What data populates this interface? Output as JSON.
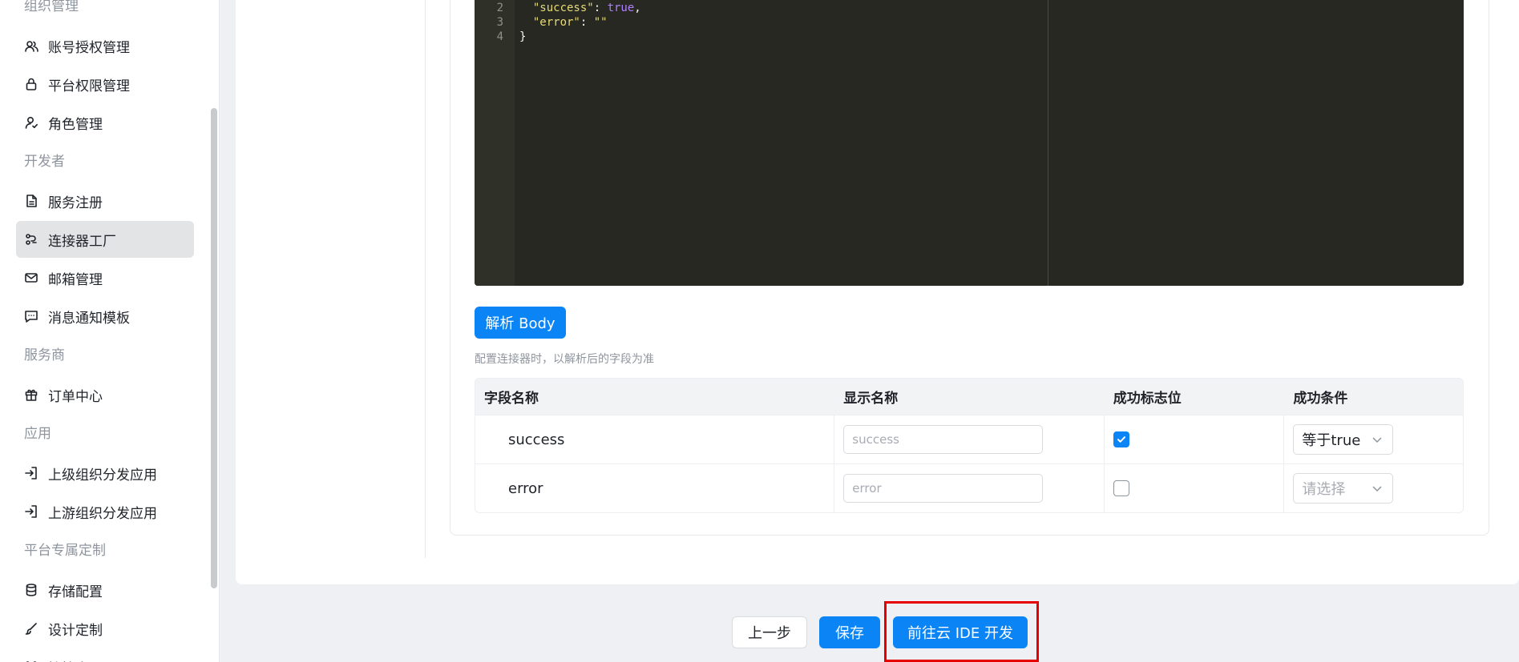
{
  "sidebar": {
    "items": [
      {
        "type": "section",
        "label": "组织管理"
      },
      {
        "type": "item",
        "label": "账号授权管理",
        "icon": "users-icon"
      },
      {
        "type": "item",
        "label": "平台权限管理",
        "icon": "lock-icon"
      },
      {
        "type": "item",
        "label": "角色管理",
        "icon": "user-role-icon"
      },
      {
        "type": "section",
        "label": "开发者"
      },
      {
        "type": "item",
        "label": "服务注册",
        "icon": "document-icon"
      },
      {
        "type": "item",
        "label": "连接器工厂",
        "icon": "connector-icon",
        "active": true
      },
      {
        "type": "item",
        "label": "邮箱管理",
        "icon": "mail-icon"
      },
      {
        "type": "item",
        "label": "消息通知模板",
        "icon": "message-icon"
      },
      {
        "type": "section",
        "label": "服务商"
      },
      {
        "type": "item",
        "label": "订单中心",
        "icon": "gift-icon"
      },
      {
        "type": "section",
        "label": "应用"
      },
      {
        "type": "item",
        "label": "上级组织分发应用",
        "icon": "login-icon"
      },
      {
        "type": "item",
        "label": "上游组织分发应用",
        "icon": "login-icon"
      },
      {
        "type": "section",
        "label": "平台专属定制"
      },
      {
        "type": "item",
        "label": "存储配置",
        "icon": "database-icon"
      },
      {
        "type": "item",
        "label": "设计定制",
        "icon": "brush-icon"
      },
      {
        "type": "item",
        "label": "管控中心",
        "icon": "command-icon"
      }
    ]
  },
  "editor": {
    "lines": [
      {
        "no": "2",
        "key": "\"success\"",
        "sep": ": ",
        "value": "true",
        "tail": ","
      },
      {
        "no": "3",
        "key": "\"error\"",
        "sep": ": ",
        "value": "\"\"",
        "tail": ""
      },
      {
        "no": "4",
        "key": "",
        "sep": "",
        "value": "",
        "tail": "}"
      }
    ]
  },
  "parse_button": "解析 Body",
  "hint": "配置连接器时，以解析后的字段为准",
  "table": {
    "headers": [
      "字段名称",
      "显示名称",
      "成功标志位",
      "成功条件"
    ],
    "rows": [
      {
        "field": "success",
        "display_placeholder": "success",
        "flag": true,
        "condition": "等于true",
        "condition_placeholder": false
      },
      {
        "field": "error",
        "display_placeholder": "error",
        "flag": false,
        "condition": "请选择",
        "condition_placeholder": true
      }
    ]
  },
  "footer": {
    "prev": "上一步",
    "save": "保存",
    "ide": "前往云 IDE 开发"
  },
  "colors": {
    "primary": "#0b84f5",
    "highlight": "#e60000",
    "editor_bg": "#272822"
  }
}
